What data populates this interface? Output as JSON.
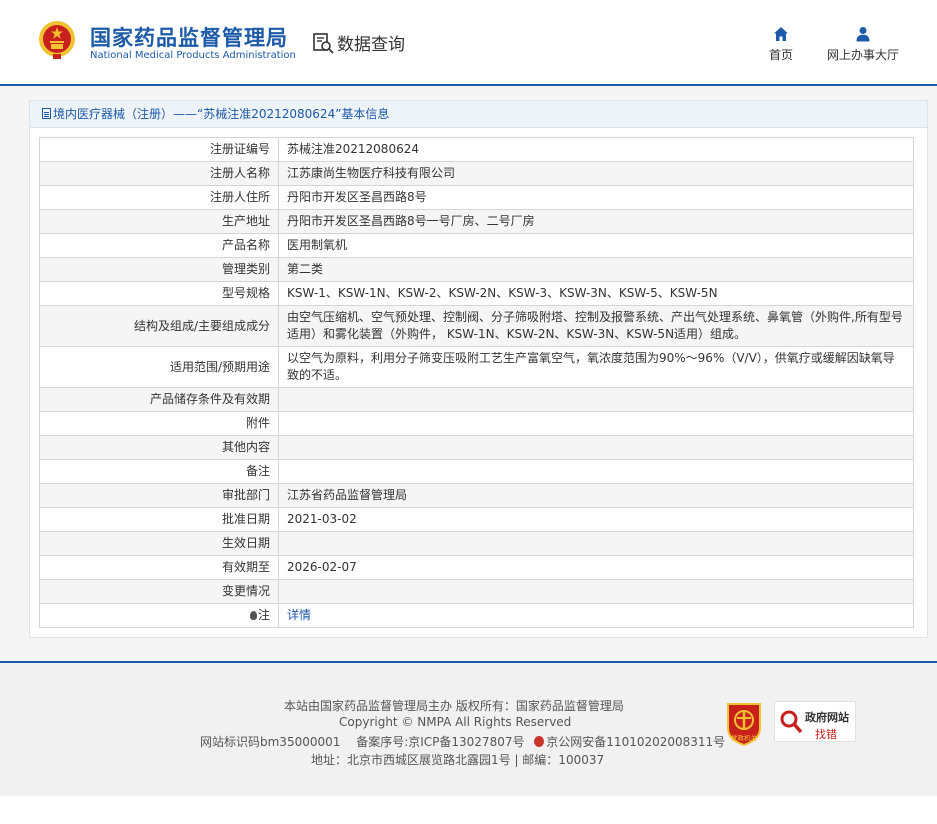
{
  "header": {
    "logo_cn": "国家药品监督管理局",
    "logo_en": "National Medical Products Administration",
    "query_title": "数据查询",
    "nav": [
      {
        "label": "首页",
        "icon": "home-icon"
      },
      {
        "label": "网上办事大厅",
        "icon": "user-icon"
      }
    ]
  },
  "panel": {
    "title": "境内医疗器械（注册）——“苏械注准20212080624”基本信息",
    "rows": [
      {
        "label": "注册证编号",
        "value": "苏械注准20212080624"
      },
      {
        "label": "注册人名称",
        "value": "江苏康尚生物医疗科技有限公司"
      },
      {
        "label": "注册人住所",
        "value": "丹阳市开发区圣昌西路8号"
      },
      {
        "label": "生产地址",
        "value": "丹阳市开发区圣昌西路8号一号厂房、二号厂房"
      },
      {
        "label": "产品名称",
        "value": "医用制氧机"
      },
      {
        "label": "管理类别",
        "value": "第二类"
      },
      {
        "label": "型号规格",
        "value": "KSW-1、KSW-1N、KSW-2、KSW-2N、KSW-3、KSW-3N、KSW-5、KSW-5N"
      },
      {
        "label": "结构及组成/主要组成成分",
        "value": "由空气压缩机、空气预处理、控制阀、分子筛吸附塔、控制及报警系统、产出气处理系统、鼻氧管（外购件,所有型号适用）和雾化装置（外购件， KSW-1N、KSW-2N、KSW-3N、KSW-5N适用）组成。"
      },
      {
        "label": "适用范围/预期用途",
        "value": "以空气为原料，利用分子筛变压吸附工艺生产富氧空气，氧浓度范围为90%～96%（V/V），供氧疗或缓解因缺氧导致的不适。"
      },
      {
        "label": "产品储存条件及有效期",
        "value": ""
      },
      {
        "label": "附件",
        "value": ""
      },
      {
        "label": "其他内容",
        "value": ""
      },
      {
        "label": "备注",
        "value": ""
      },
      {
        "label": "审批部门",
        "value": "江苏省药品监督管理局"
      },
      {
        "label": "批准日期",
        "value": "2021-03-02"
      },
      {
        "label": "生效日期",
        "value": ""
      },
      {
        "label": "有效期至",
        "value": "2026-02-07"
      },
      {
        "label": "变更情况",
        "value": ""
      }
    ],
    "note_label": "注",
    "note_link": "详情"
  },
  "footer": {
    "line1": "本站由国家药品监督管理局主办 版权所有：国家药品监督管理局",
    "line2": "Copyright © NMPA All Rights Reserved",
    "line3_a": "网站标识码bm35000001　 备案序号:京ICP备13027807号 ",
    "line3_b": "京公网安备11010202008311号",
    "line4": "地址：北京市西城区展览路北露园1号 | 邮编：100037",
    "badge1_text": "党政机关",
    "badge2_title": "政府网站",
    "badge2_sub": "找错"
  },
  "colors": {
    "brand_blue": "#1d5aa8",
    "emblem_red": "#c8201d",
    "emblem_gold": "#f2c230"
  }
}
